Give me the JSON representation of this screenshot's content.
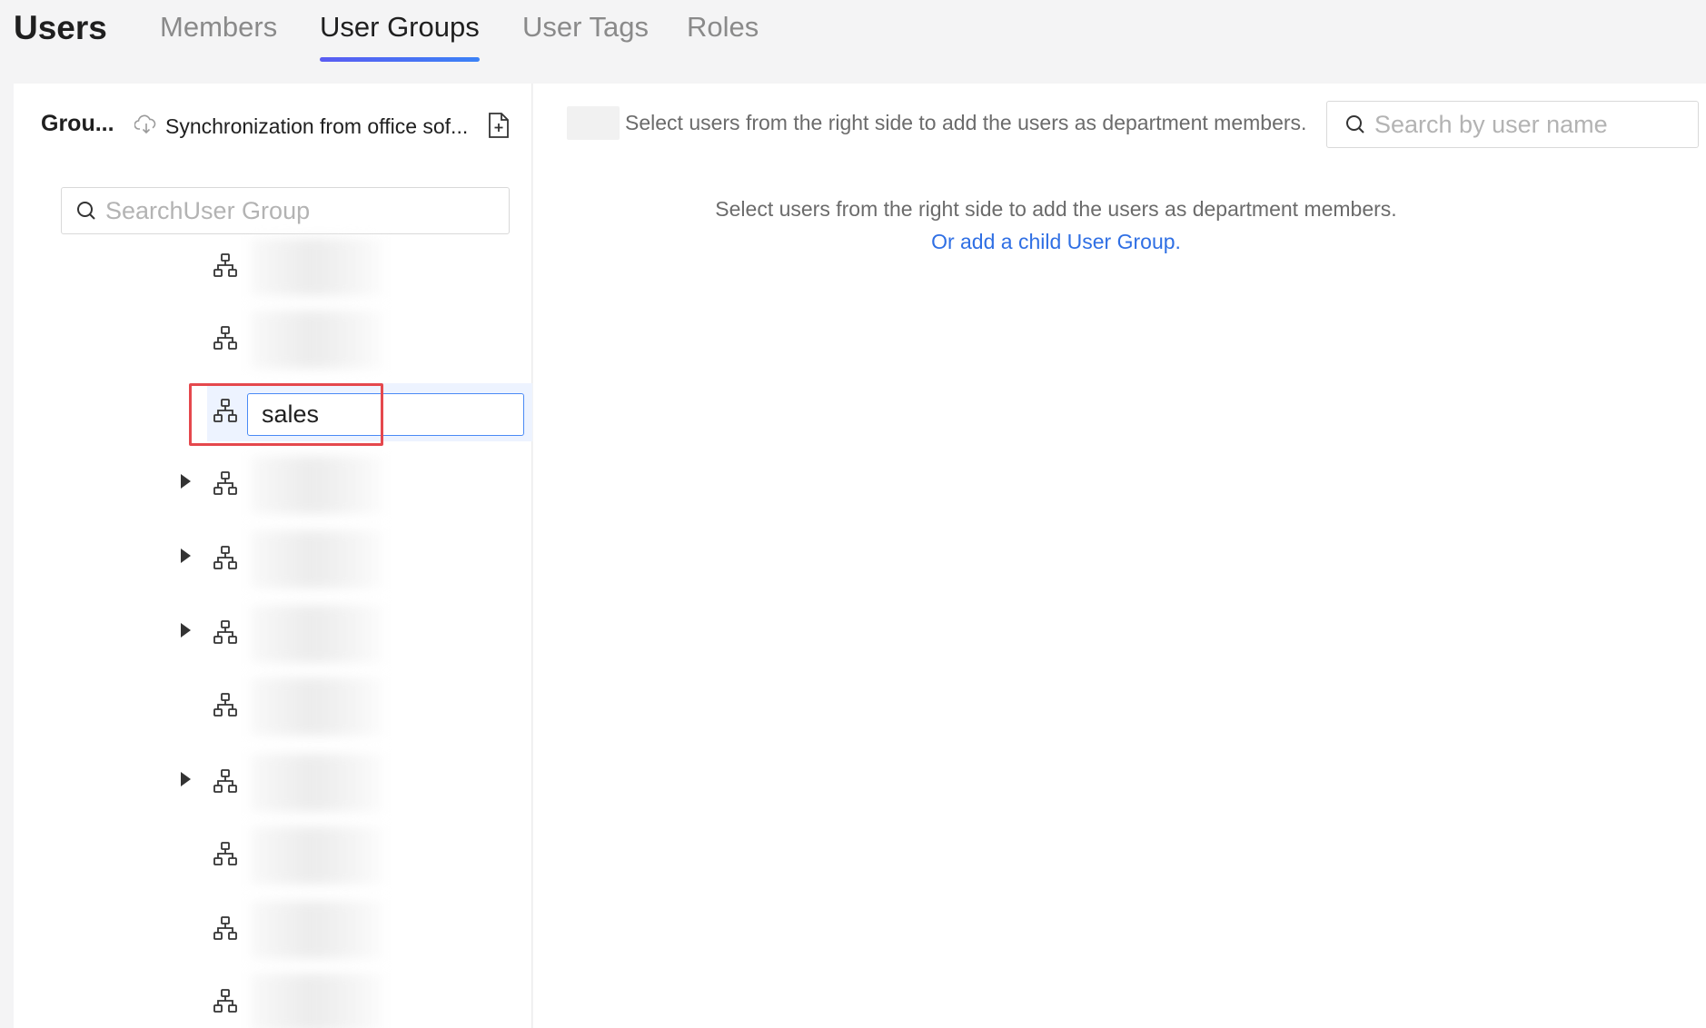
{
  "header": {
    "title": "Users",
    "tabs": [
      {
        "label": "Members",
        "active": false
      },
      {
        "label": "User Groups",
        "active": true
      },
      {
        "label": "User Tags",
        "active": false
      },
      {
        "label": "Roles",
        "active": false
      }
    ]
  },
  "left_panel": {
    "groups_label": "Grou...",
    "sync_label": "Synchronization from office sof...",
    "sync_icon": "cloud-download-icon",
    "add_icon": "add-document-icon",
    "search_placeholder": "SearchUser Group",
    "tree": {
      "node_icon": "org-structure-icon",
      "editing_value": "sales",
      "rows": [
        {
          "has_caret": false,
          "state": "blurred"
        },
        {
          "has_caret": false,
          "state": "blurred"
        },
        {
          "has_caret": false,
          "state": "editing"
        },
        {
          "has_caret": true,
          "state": "blurred"
        },
        {
          "has_caret": true,
          "state": "blurred"
        },
        {
          "has_caret": true,
          "state": "blurred"
        },
        {
          "has_caret": false,
          "state": "blurred"
        },
        {
          "has_caret": true,
          "state": "blurred"
        },
        {
          "has_caret": false,
          "state": "blurred"
        },
        {
          "has_caret": false,
          "state": "blurred"
        },
        {
          "has_caret": false,
          "state": "blurred"
        }
      ]
    }
  },
  "right_panel": {
    "hint": "Select users from the right side to add the users as department members.",
    "search_placeholder": "Search by user name",
    "empty_message": "Select users from the right side to add the users as department members.",
    "add_child_link": "Or add a child User Group."
  },
  "colors": {
    "accent": "#3b82f6",
    "link": "#2f6fe4",
    "highlight": "#e5484d",
    "selected_row_bg": "#edf3ff"
  }
}
